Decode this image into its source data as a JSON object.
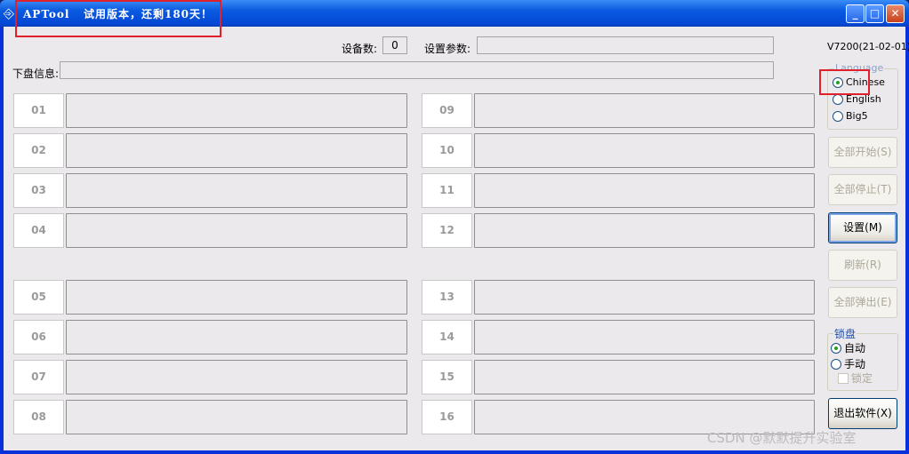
{
  "window": {
    "title": "APTool   试用版本，还剩180天！",
    "minimize": "_",
    "maximize": "□",
    "close": "✕"
  },
  "header": {
    "device_count_label": "设备数:",
    "device_count": "0",
    "settings_param_label": "设置参数:",
    "settings_param_value": "",
    "disk_info_label": "下盘信息:",
    "disk_info_value": "",
    "version": "V7200(21-02-01)"
  },
  "slots": [
    "01",
    "02",
    "03",
    "04",
    "05",
    "06",
    "07",
    "08",
    "09",
    "10",
    "11",
    "12",
    "13",
    "14",
    "15",
    "16"
  ],
  "language": {
    "title": "Language",
    "options": [
      "Chinese",
      "English",
      "Big5"
    ],
    "selected": "Chinese"
  },
  "buttons": {
    "start_all": "全部开始(S)",
    "stop_all": "全部停止(T)",
    "settings": "设置(M)",
    "refresh": "刷新(R)",
    "eject_all": "全部弹出(E)",
    "exit": "退出软件(X)"
  },
  "lock": {
    "title": "锁盘",
    "auto": "自动",
    "manual": "手动",
    "lock": "锁定",
    "selected": "自动",
    "locked": false
  },
  "watermark": "CSDN @默默提升实验室"
}
